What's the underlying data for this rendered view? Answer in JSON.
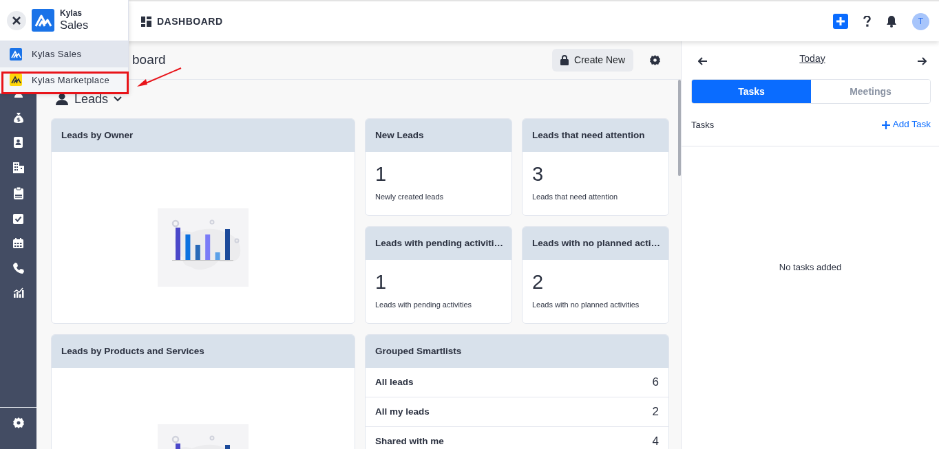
{
  "app_switcher": {
    "brand_top": "Kylas",
    "brand_bottom": "Sales",
    "items": [
      {
        "label": "Kylas Sales",
        "color": "#1a73e8",
        "selected": true,
        "annotated": false
      },
      {
        "label": "Kylas Marketplace",
        "color": "#ffd60a",
        "selected": false,
        "annotated": true
      }
    ]
  },
  "header": {
    "title": "DASHBOARD",
    "avatar": "T"
  },
  "page": {
    "heading": "board",
    "create_button": "Create New",
    "entity": "Leads"
  },
  "cards": [
    {
      "kind": "chart",
      "title": "Leads by Owner"
    },
    {
      "kind": "metric",
      "title": "New Leads",
      "value": "1",
      "caption": "Newly created leads"
    },
    {
      "kind": "metric",
      "title": "Leads that need attention",
      "value": "3",
      "caption": "Leads that need attention"
    },
    {
      "kind": "metric",
      "title": "Leads with pending activiti…",
      "value": "1",
      "caption": "Leads with pending activities"
    },
    {
      "kind": "metric",
      "title": "Leads with no planned acti…",
      "value": "2",
      "caption": "Leads with no planned activities"
    },
    {
      "kind": "chart",
      "title": "Leads by Products and Services"
    },
    {
      "kind": "list",
      "title": "Grouped Smartlists",
      "rows": [
        {
          "label": "All leads",
          "count": "6"
        },
        {
          "label": "All my leads",
          "count": "2"
        },
        {
          "label": "Shared with me",
          "count": "4"
        }
      ]
    }
  ],
  "right_panel": {
    "date": "Today",
    "tabs": [
      {
        "label": "Tasks",
        "selected": true
      },
      {
        "label": "Meetings",
        "selected": false
      }
    ],
    "section": "Tasks",
    "add_link": "Add Task",
    "empty": "No tasks added"
  }
}
